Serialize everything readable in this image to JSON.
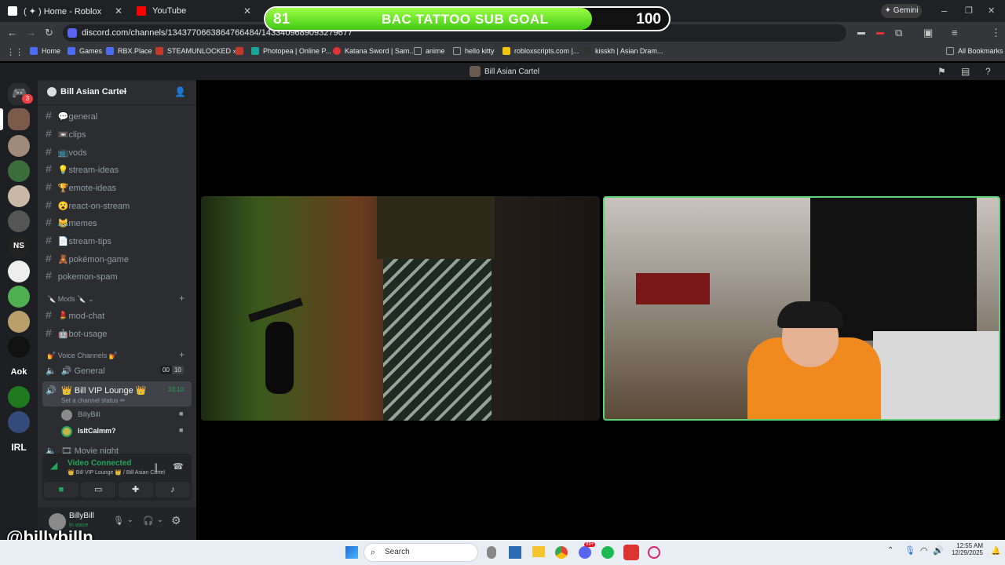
{
  "browser": {
    "tabs": [
      {
        "title": "( ✦ ) Home - Roblox",
        "color": "#ffffff"
      },
      {
        "title": "YouTube",
        "color": "#ff0000"
      }
    ],
    "url": "discord.com/channels/1343770663864766484/1433409689093279677",
    "profile_button": "Gemini",
    "bookmarks": [
      {
        "label": "Home",
        "color": "#4a6cf7"
      },
      {
        "label": "Games",
        "color": "#4a6cf7"
      },
      {
        "label": "RBX.Place",
        "color": "#4a6cf7"
      },
      {
        "label": "STEAMUNLOCKED »...",
        "color": "#c0392b"
      },
      {
        "label": "",
        "color": "#c0392b"
      },
      {
        "label": "Photopea | Online P...",
        "color": "#18a497"
      },
      {
        "label": "Katana Sword | Sam...",
        "color": "#e03333"
      },
      {
        "label": "anime",
        "color": "#9aa0a6"
      },
      {
        "label": "hello kitty",
        "color": "#9aa0a6"
      },
      {
        "label": "robloxscripts.com |...",
        "color": "#f1c40f"
      },
      {
        "label": "kisskh | Asian Dram...",
        "color": "#333333"
      }
    ],
    "all_bookmarks": "All Bookmarks"
  },
  "overlay": {
    "goal_current": "81",
    "goal_title": "BAC TATTOO SUB GOAL",
    "goal_target": "100",
    "progress_fraction": 0.81,
    "watermark": "@billybilln"
  },
  "discord": {
    "window_title": "Bill Asian Cartel",
    "server_name": "Bill Asian Cartel",
    "home_badge": "3",
    "channels": [
      {
        "emoji": "💬",
        "name": "general"
      },
      {
        "emoji": "📼",
        "name": "clips"
      },
      {
        "emoji": "📺",
        "name": "vods"
      },
      {
        "emoji": "💡",
        "name": "stream-ideas"
      },
      {
        "emoji": "🏆",
        "name": "emote-ideas"
      },
      {
        "emoji": "😮",
        "name": "react-on-stream"
      },
      {
        "emoji": "😹",
        "name": "memes"
      },
      {
        "emoji": "📄",
        "name": "stream-tips"
      },
      {
        "emoji": "🧸",
        "name": "pokémon-game"
      },
      {
        "emoji": "",
        "name": "pokemon-spam"
      }
    ],
    "mods_category": "🔪 Mods 🔪",
    "mod_channels": [
      {
        "emoji": "💄",
        "name": "mod-chat"
      },
      {
        "emoji": "🤖",
        "name": "bot-usage"
      }
    ],
    "voice_category": "💅 Voice Channels 💅",
    "voice_general": {
      "name": "🔊 General",
      "count_a": "00",
      "count_b": "10"
    },
    "voice_active": {
      "name": "👑 Bill VIP Lounge 👑",
      "timer": "33:10",
      "status": "Set a channel status ✏"
    },
    "voice_members": [
      {
        "name": "BillyBill"
      },
      {
        "name": "IsItCalmm?"
      }
    ],
    "voice_next": "🎞 Movie night",
    "connection": {
      "status": "Video Connected",
      "location": "👑 Bill VIP Lounge 👑 / Bill Asian Cartel"
    },
    "user": {
      "name": "BillyBill",
      "status": "In voice"
    }
  },
  "taskbar": {
    "search_placeholder": "Search",
    "time": "12:55 AM",
    "date": "12/29/2025",
    "notif_badge": "99+"
  },
  "colors": {
    "discord_green": "#23a55a",
    "active_frame": "#5cd17a",
    "goal_green": "#7cf034"
  }
}
